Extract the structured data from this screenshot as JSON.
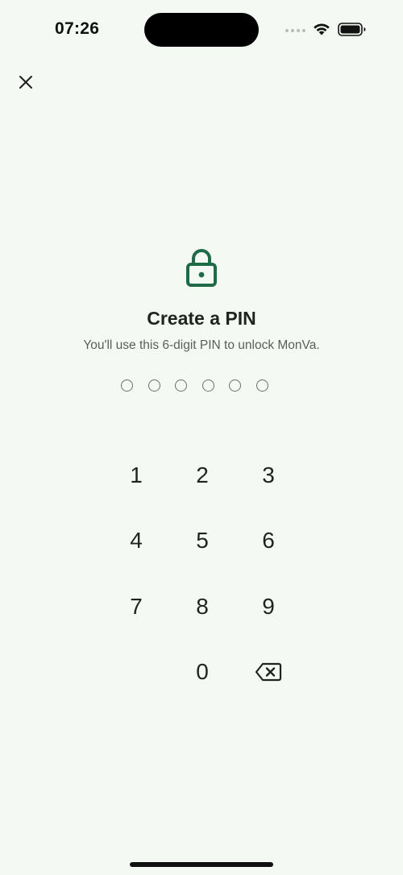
{
  "status_bar": {
    "time": "07:26"
  },
  "header": {
    "close_icon": "close-icon"
  },
  "main": {
    "icon": "lock-icon",
    "accent_color": "#1f6b47",
    "title": "Create a PIN",
    "subtitle": "You'll use this 6-digit PIN to unlock MonVa.",
    "pin_length": 6,
    "pin_filled": 0
  },
  "keypad": {
    "keys": [
      "1",
      "2",
      "3",
      "4",
      "5",
      "6",
      "7",
      "8",
      "9",
      "",
      "0",
      "backspace"
    ],
    "backspace_icon": "backspace-icon"
  }
}
